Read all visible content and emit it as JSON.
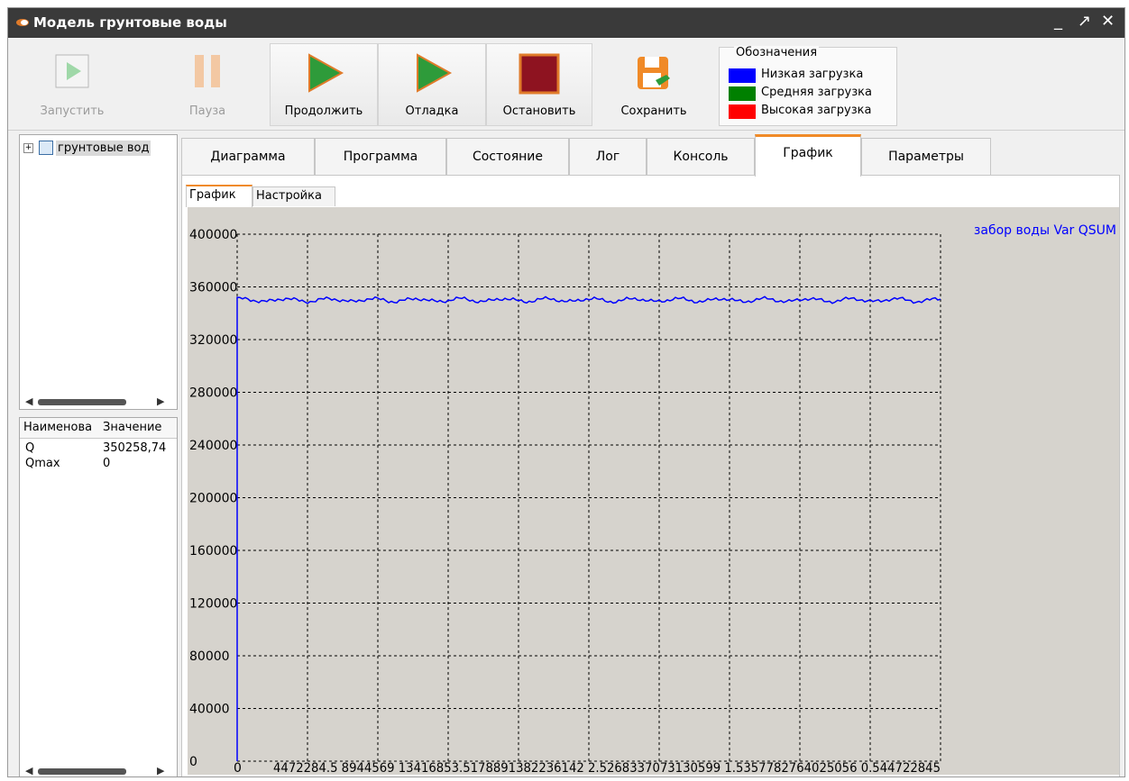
{
  "window": {
    "title": "Модель грунтовые воды",
    "controls": {
      "minimize": "_",
      "maximize": "↗",
      "close": "✕"
    }
  },
  "toolbar": {
    "buttons": [
      {
        "key": "run",
        "label": "Запустить",
        "icon": "play-icon",
        "enabled": false
      },
      {
        "key": "pause",
        "label": "Пауза",
        "icon": "pause-icon",
        "enabled": false
      },
      {
        "key": "continue",
        "label": "Продолжить",
        "icon": "play-icon",
        "enabled": true
      },
      {
        "key": "debug",
        "label": "Отладка",
        "icon": "play-icon",
        "enabled": true
      },
      {
        "key": "stop",
        "label": "Остановить",
        "icon": "stop-icon",
        "enabled": true
      },
      {
        "key": "save",
        "label": "Сохранить",
        "icon": "save-icon",
        "enabled": true
      }
    ],
    "legend": {
      "title": "Обозначения",
      "items": [
        {
          "label": "Низкая загрузка",
          "color": "#0000ff"
        },
        {
          "label": "Средняя загрузка",
          "color": "#008000"
        },
        {
          "label": "Высокая загрузка",
          "color": "#ff0000"
        }
      ]
    }
  },
  "tree": {
    "root_label": "грунтовые вод",
    "expander": "+"
  },
  "properties": {
    "columns": [
      "Наименова",
      "Значение"
    ],
    "rows": [
      {
        "name": "Q",
        "value": "350258,74"
      },
      {
        "name": "Qmax",
        "value": "0"
      }
    ]
  },
  "tabs": {
    "items": [
      "Диаграмма",
      "Программа",
      "Состояние",
      "Лог",
      "Консоль",
      "График",
      "Параметры"
    ],
    "active": "График"
  },
  "subtabs": {
    "items": [
      "График",
      "Настройка"
    ],
    "active": "График"
  },
  "chart_data": {
    "type": "line",
    "series": [
      {
        "name": "забор воды Var QSUM",
        "color": "#0000ff",
        "baseline": 350000
      }
    ],
    "x_ticks": [
      "0",
      "4472284.5",
      "8944569",
      "13416853.5",
      "17889138",
      "22361422.5",
      "26833707",
      "31305991.5",
      "35778276",
      "40250560.5",
      "44722845"
    ],
    "x_tick_text": "4472284.5 8944569 13416853.5178891382236142 2.5268337073130599 1.5357782764025056 0.544722845",
    "y_ticks": [
      "0",
      "40000",
      "80000",
      "120000",
      "160000",
      "200000",
      "240000",
      "280000",
      "320000",
      "360000",
      "400000"
    ],
    "xlim": [
      0,
      44722845
    ],
    "ylim": [
      0,
      400000
    ],
    "grid": true,
    "grid_style": "dashed",
    "background": "#d6d3cd"
  }
}
